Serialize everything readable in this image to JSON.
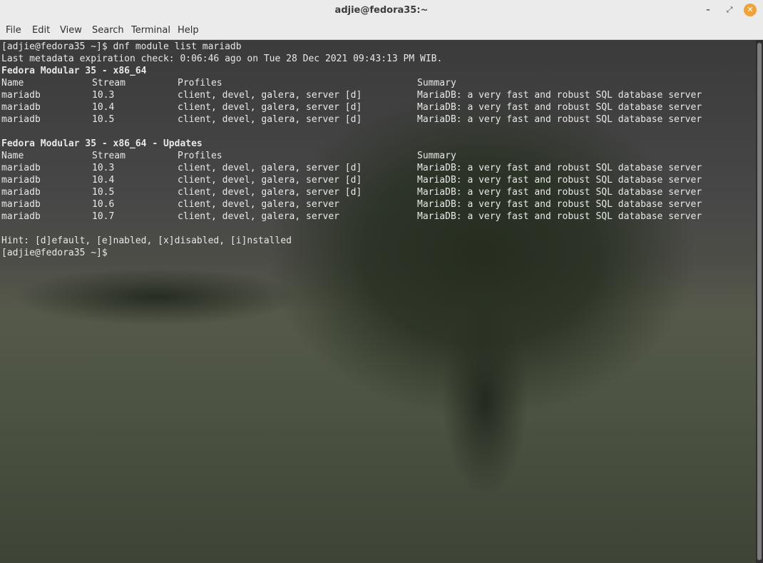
{
  "window": {
    "title": "adjie@fedora35:~",
    "minimize_glyph": "–",
    "maximize_glyph": "⤢",
    "close_glyph": "✕"
  },
  "menubar": [
    "File",
    "Edit",
    "View",
    "Search",
    "Terminal",
    "Help"
  ],
  "terminal": {
    "command_line": "[adjie@fedora35 ~]$ dnf module list mariadb",
    "metadata_line": "Last metadata expiration check: 0:06:46 ago on Tue 28 Dec 2021 09:43:13 PM WIB.",
    "sections": [
      {
        "title": "Fedora Modular 35 - x86_64",
        "headers": [
          "Name",
          "Stream",
          "Profiles",
          "Summary"
        ],
        "rows": [
          [
            "mariadb",
            "10.3",
            "client, devel, galera, server [d]",
            "MariaDB: a very fast and robust SQL database server"
          ],
          [
            "mariadb",
            "10.4",
            "client, devel, galera, server [d]",
            "MariaDB: a very fast and robust SQL database server"
          ],
          [
            "mariadb",
            "10.5",
            "client, devel, galera, server [d]",
            "MariaDB: a very fast and robust SQL database server"
          ]
        ]
      },
      {
        "title": "Fedora Modular 35 - x86_64 - Updates",
        "headers": [
          "Name",
          "Stream",
          "Profiles",
          "Summary"
        ],
        "rows": [
          [
            "mariadb",
            "10.3",
            "client, devel, galera, server [d]",
            "MariaDB: a very fast and robust SQL database server"
          ],
          [
            "mariadb",
            "10.4",
            "client, devel, galera, server [d]",
            "MariaDB: a very fast and robust SQL database server"
          ],
          [
            "mariadb",
            "10.5",
            "client, devel, galera, server [d]",
            "MariaDB: a very fast and robust SQL database server"
          ],
          [
            "mariadb",
            "10.6",
            "client, devel, galera, server",
            "MariaDB: a very fast and robust SQL database server"
          ],
          [
            "mariadb",
            "10.7",
            "client, devel, galera, server",
            "MariaDB: a very fast and robust SQL database server"
          ]
        ]
      }
    ],
    "hint_line": "Hint: [d]efault, [e]nabled, [x]disabled, [i]nstalled",
    "prompt": "[adjie@fedora35 ~]$ "
  }
}
